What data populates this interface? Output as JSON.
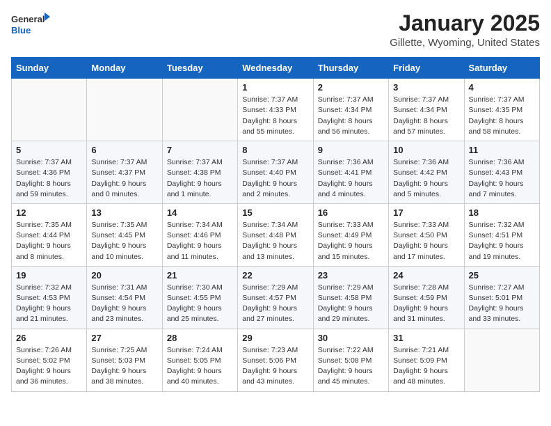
{
  "header": {
    "logo_general": "General",
    "logo_blue": "Blue",
    "month_title": "January 2025",
    "location": "Gillette, Wyoming, United States"
  },
  "days_of_week": [
    "Sunday",
    "Monday",
    "Tuesday",
    "Wednesday",
    "Thursday",
    "Friday",
    "Saturday"
  ],
  "weeks": [
    [
      {
        "day": "",
        "info": ""
      },
      {
        "day": "",
        "info": ""
      },
      {
        "day": "",
        "info": ""
      },
      {
        "day": "1",
        "info": "Sunrise: 7:37 AM\nSunset: 4:33 PM\nDaylight: 8 hours\nand 55 minutes."
      },
      {
        "day": "2",
        "info": "Sunrise: 7:37 AM\nSunset: 4:34 PM\nDaylight: 8 hours\nand 56 minutes."
      },
      {
        "day": "3",
        "info": "Sunrise: 7:37 AM\nSunset: 4:34 PM\nDaylight: 8 hours\nand 57 minutes."
      },
      {
        "day": "4",
        "info": "Sunrise: 7:37 AM\nSunset: 4:35 PM\nDaylight: 8 hours\nand 58 minutes."
      }
    ],
    [
      {
        "day": "5",
        "info": "Sunrise: 7:37 AM\nSunset: 4:36 PM\nDaylight: 8 hours\nand 59 minutes."
      },
      {
        "day": "6",
        "info": "Sunrise: 7:37 AM\nSunset: 4:37 PM\nDaylight: 9 hours\nand 0 minutes."
      },
      {
        "day": "7",
        "info": "Sunrise: 7:37 AM\nSunset: 4:38 PM\nDaylight: 9 hours\nand 1 minute."
      },
      {
        "day": "8",
        "info": "Sunrise: 7:37 AM\nSunset: 4:40 PM\nDaylight: 9 hours\nand 2 minutes."
      },
      {
        "day": "9",
        "info": "Sunrise: 7:36 AM\nSunset: 4:41 PM\nDaylight: 9 hours\nand 4 minutes."
      },
      {
        "day": "10",
        "info": "Sunrise: 7:36 AM\nSunset: 4:42 PM\nDaylight: 9 hours\nand 5 minutes."
      },
      {
        "day": "11",
        "info": "Sunrise: 7:36 AM\nSunset: 4:43 PM\nDaylight: 9 hours\nand 7 minutes."
      }
    ],
    [
      {
        "day": "12",
        "info": "Sunrise: 7:35 AM\nSunset: 4:44 PM\nDaylight: 9 hours\nand 8 minutes."
      },
      {
        "day": "13",
        "info": "Sunrise: 7:35 AM\nSunset: 4:45 PM\nDaylight: 9 hours\nand 10 minutes."
      },
      {
        "day": "14",
        "info": "Sunrise: 7:34 AM\nSunset: 4:46 PM\nDaylight: 9 hours\nand 11 minutes."
      },
      {
        "day": "15",
        "info": "Sunrise: 7:34 AM\nSunset: 4:48 PM\nDaylight: 9 hours\nand 13 minutes."
      },
      {
        "day": "16",
        "info": "Sunrise: 7:33 AM\nSunset: 4:49 PM\nDaylight: 9 hours\nand 15 minutes."
      },
      {
        "day": "17",
        "info": "Sunrise: 7:33 AM\nSunset: 4:50 PM\nDaylight: 9 hours\nand 17 minutes."
      },
      {
        "day": "18",
        "info": "Sunrise: 7:32 AM\nSunset: 4:51 PM\nDaylight: 9 hours\nand 19 minutes."
      }
    ],
    [
      {
        "day": "19",
        "info": "Sunrise: 7:32 AM\nSunset: 4:53 PM\nDaylight: 9 hours\nand 21 minutes."
      },
      {
        "day": "20",
        "info": "Sunrise: 7:31 AM\nSunset: 4:54 PM\nDaylight: 9 hours\nand 23 minutes."
      },
      {
        "day": "21",
        "info": "Sunrise: 7:30 AM\nSunset: 4:55 PM\nDaylight: 9 hours\nand 25 minutes."
      },
      {
        "day": "22",
        "info": "Sunrise: 7:29 AM\nSunset: 4:57 PM\nDaylight: 9 hours\nand 27 minutes."
      },
      {
        "day": "23",
        "info": "Sunrise: 7:29 AM\nSunset: 4:58 PM\nDaylight: 9 hours\nand 29 minutes."
      },
      {
        "day": "24",
        "info": "Sunrise: 7:28 AM\nSunset: 4:59 PM\nDaylight: 9 hours\nand 31 minutes."
      },
      {
        "day": "25",
        "info": "Sunrise: 7:27 AM\nSunset: 5:01 PM\nDaylight: 9 hours\nand 33 minutes."
      }
    ],
    [
      {
        "day": "26",
        "info": "Sunrise: 7:26 AM\nSunset: 5:02 PM\nDaylight: 9 hours\nand 36 minutes."
      },
      {
        "day": "27",
        "info": "Sunrise: 7:25 AM\nSunset: 5:03 PM\nDaylight: 9 hours\nand 38 minutes."
      },
      {
        "day": "28",
        "info": "Sunrise: 7:24 AM\nSunset: 5:05 PM\nDaylight: 9 hours\nand 40 minutes."
      },
      {
        "day": "29",
        "info": "Sunrise: 7:23 AM\nSunset: 5:06 PM\nDaylight: 9 hours\nand 43 minutes."
      },
      {
        "day": "30",
        "info": "Sunrise: 7:22 AM\nSunset: 5:08 PM\nDaylight: 9 hours\nand 45 minutes."
      },
      {
        "day": "31",
        "info": "Sunrise: 7:21 AM\nSunset: 5:09 PM\nDaylight: 9 hours\nand 48 minutes."
      },
      {
        "day": "",
        "info": ""
      }
    ]
  ]
}
